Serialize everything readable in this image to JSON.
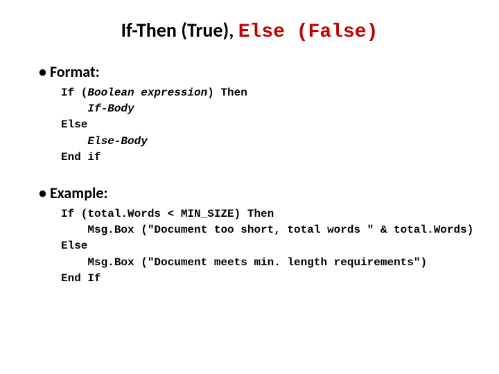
{
  "title": {
    "part1": "If-Then (True)",
    "part2_sep": ", ",
    "part2": "Else (False)"
  },
  "sections": {
    "format": {
      "heading": "Format:",
      "lines": {
        "l1a": "If (",
        "l1b": "Boolean expression",
        "l1c": ") Then",
        "l2": "    If-Body",
        "l3": "Else",
        "l4": "    Else-Body",
        "l5": "End if"
      }
    },
    "example": {
      "heading": "Example:",
      "lines": {
        "l1": "If (total.Words < MIN_SIZE) Then",
        "l2": "    Msg.Box (\"Document too short, total words \" & total.Words)",
        "l3": "Else",
        "l4": "    Msg.Box (\"Document meets min. length requirements\")",
        "l5": "End If"
      }
    }
  }
}
